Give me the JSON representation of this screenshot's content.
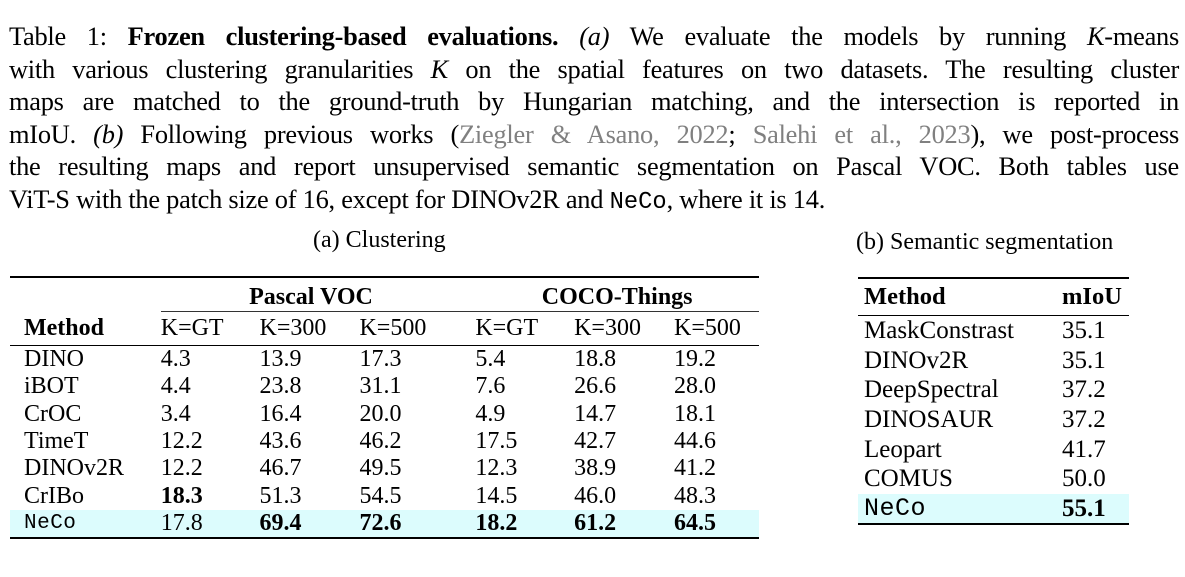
{
  "caption": {
    "label": "Table 1:",
    "title": "Frozen clustering-based evaluations.",
    "a_marker": "(a)",
    "line1_rest": "We evaluate the models by running",
    "K": "K",
    "kmeans": "-means",
    "line2_a": "with various clustering granularities",
    "line2_b": "on the spatial features on two datasets. The resulting cluster",
    "line3": "maps are matched to the ground-truth by Hungarian matching, and the intersection is reported in",
    "line4_a": "mIoU.",
    "b_marker": "(b)",
    "line4_b": "Following previous works (",
    "cite1_author": "Ziegler & Asano",
    "cite1_year": "2022",
    "cite2_author": "Salehi et al.",
    "cite2_year": "2023",
    "line4_c": "), we post-process",
    "line5": "the resulting maps and report unsupervised semantic segmentation on Pascal VOC. Both tables use",
    "line6_a": "ViT-S with the patch size of 16, except for DINOv2R and",
    "neco": "NeCo",
    "line6_b": ", where it is 14."
  },
  "table_a": {
    "subcaption": "(a) Clustering",
    "method_header": "Method",
    "groups": [
      "Pascal VOC",
      "COCO-Things"
    ],
    "columns": [
      "K=GT",
      "K=300",
      "K=500",
      "K=GT",
      "K=300",
      "K=500"
    ],
    "rows": [
      {
        "method": "DINO",
        "values": [
          "4.3",
          "13.9",
          "17.3",
          "5.4",
          "18.8",
          "19.2"
        ]
      },
      {
        "method": "iBOT",
        "values": [
          "4.4",
          "23.8",
          "31.1",
          "7.6",
          "26.6",
          "28.0"
        ]
      },
      {
        "method": "CrOC",
        "values": [
          "3.4",
          "16.4",
          "20.0",
          "4.9",
          "14.7",
          "18.1"
        ]
      },
      {
        "method": "TimeT",
        "values": [
          "12.2",
          "43.6",
          "46.2",
          "17.5",
          "42.7",
          "44.6"
        ]
      },
      {
        "method": "DINOv2R",
        "values": [
          "12.2",
          "46.7",
          "49.5",
          "12.3",
          "38.9",
          "41.2"
        ]
      },
      {
        "method": "CrIBo",
        "values": [
          "18.3",
          "51.3",
          "54.5",
          "14.5",
          "46.0",
          "48.3"
        ]
      },
      {
        "method": "NeCo",
        "values": [
          "17.8",
          "69.4",
          "72.6",
          "18.2",
          "61.2",
          "64.5"
        ]
      }
    ],
    "bold_cells": [
      [
        5,
        0
      ],
      [
        6,
        1
      ],
      [
        6,
        2
      ],
      [
        6,
        3
      ],
      [
        6,
        4
      ],
      [
        6,
        5
      ]
    ],
    "highlight_row": "NeCo",
    "highlight_color": "#dcfcfd"
  },
  "table_b": {
    "subcaption": "(b) Semantic segmentation",
    "headers": [
      "Method",
      "mIoU"
    ],
    "rows": [
      {
        "method": "MaskConstrast",
        "miou": "35.1"
      },
      {
        "method": "DINOv2R",
        "miou": "35.1"
      },
      {
        "method": "DeepSpectral",
        "miou": "37.2"
      },
      {
        "method": "DINOSAUR",
        "miou": "37.2"
      },
      {
        "method": "Leopart",
        "miou": "41.7"
      },
      {
        "method": "COMUS",
        "miou": "50.0"
      },
      {
        "method": "NeCo",
        "miou": "55.1"
      }
    ],
    "highlight_row": "NeCo",
    "highlight_color": "#dcfcfd"
  }
}
